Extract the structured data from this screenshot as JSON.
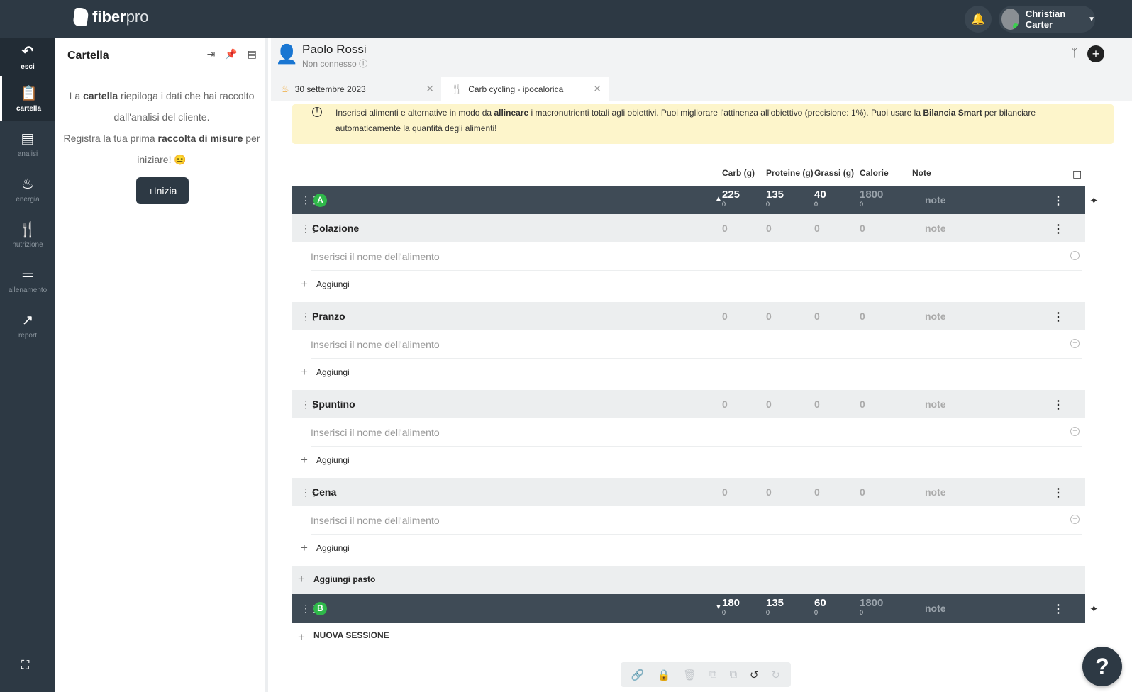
{
  "app": {
    "brand_main": "fiber",
    "brand_sub": "pro"
  },
  "header": {
    "user_name": "Christian Carter",
    "notifications_icon": "bell-icon"
  },
  "sidebar": {
    "items": [
      {
        "label": "esci",
        "icon": "back-arrow-icon"
      },
      {
        "label": "cartella",
        "icon": "clipboard-icon"
      },
      {
        "label": "analisi",
        "icon": "document-icon"
      },
      {
        "label": "energia",
        "icon": "flame-icon"
      },
      {
        "label": "nutrizione",
        "icon": "fork-knife-icon"
      },
      {
        "label": "allenamento",
        "icon": "dumbbell-icon"
      },
      {
        "label": "report",
        "icon": "chart-icon"
      }
    ]
  },
  "panel": {
    "title": "Cartella",
    "text_1a": "La ",
    "text_1b": "cartella",
    "text_1c": " riepiloga i dati che hai raccolto dall'analisi del cliente.",
    "text_2a": "Registra la tua prima ",
    "text_2b": "raccolta di misure",
    "text_2c": " per iniziare! 😑",
    "button": "Inizia"
  },
  "client": {
    "name": "Paolo Rossi",
    "status": "Non connesso"
  },
  "tabs": [
    {
      "label": "30 settembre 2023"
    },
    {
      "label": "Carb cycling - ipocalorica"
    }
  ],
  "alert": {
    "part1": "Inserisci alimenti e alternative in modo da ",
    "bold1": "allineare",
    "part2": " i macronutrienti totali agli obiettivi. Puoi migliorare l'attinenza all'obiettivo (precisione: 1%). Puoi usare la ",
    "bold2": "Bilancia Smart",
    "part3": " per bilanciare automaticamente la quantità degli alimenti!"
  },
  "columns": {
    "carb": "Carb (g)",
    "prot": "Proteine (g)",
    "fat": "Grassi (g)",
    "cal": "Calorie",
    "note": "Note"
  },
  "session_a": {
    "badge": "A",
    "carb": "225",
    "prot": "135",
    "fat": "40",
    "cal": "1800",
    "carb_sub": "0",
    "prot_sub": "0",
    "fat_sub": "0",
    "cal_sub": "0",
    "note": "note"
  },
  "session_b": {
    "badge": "B",
    "carb": "180",
    "prot": "135",
    "fat": "60",
    "cal": "1800",
    "carb_sub": "0",
    "prot_sub": "0",
    "fat_sub": "0",
    "cal_sub": "0",
    "note": "note"
  },
  "meals": [
    {
      "name": "Colazione",
      "carb": "0",
      "prot": "0",
      "fat": "0",
      "cal": "0",
      "note": "note"
    },
    {
      "name": "Pranzo",
      "carb": "0",
      "prot": "0",
      "fat": "0",
      "cal": "0",
      "note": "note"
    },
    {
      "name": "Spuntino",
      "carb": "0",
      "prot": "0",
      "fat": "0",
      "cal": "0",
      "note": "note"
    },
    {
      "name": "Cena",
      "carb": "0",
      "prot": "0",
      "fat": "0",
      "cal": "0",
      "note": "note"
    }
  ],
  "food_placeholder": "Inserisci il nome dell'alimento",
  "add_label": "Aggiungi",
  "add_meal_label": "Aggiungi pasto",
  "new_session_label": "NUOVA SESSIONE",
  "help_label": "?"
}
